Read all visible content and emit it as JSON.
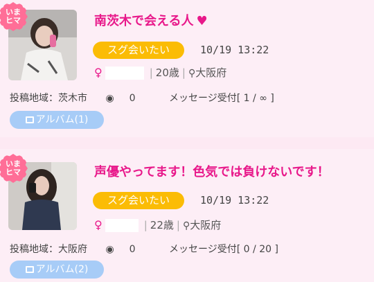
{
  "posts": [
    {
      "badge": "いま\nヒマ",
      "badge_line1": "いま",
      "badge_line2": "ヒマ",
      "title": "南茨木で会える人",
      "title_icon": "heart-icon",
      "status": "スグ会いたい",
      "datetime": "10/19 13:22",
      "gender_symbol": "♀",
      "age": "20歳",
      "location": "大阪府",
      "area_label": "投稿地域：茨木市",
      "views": "0",
      "message_label": "メッセージ受付[ 1 / ∞ ]",
      "album": "アルバム(1)"
    },
    {
      "badge": "いま\nヒマ",
      "badge_line1": "いま",
      "badge_line2": "ヒマ",
      "title": "声優やってます！色気では負けないです！",
      "status": "スグ会いたい",
      "datetime": "10/19 13:22",
      "gender_symbol": "♀",
      "age": "22歳",
      "location": "大阪府",
      "area_label": "投稿地域：大阪府",
      "views": "0",
      "message_label": "メッセージ受付[ 0 / 20 ]",
      "album": "アルバム(2)"
    }
  ],
  "colors": {
    "title": "#e8188a",
    "status_pill": "#fbbc05",
    "album_button": "#a7ccf7",
    "badge": "#ff6e97",
    "card_bg": "#fdeef6"
  }
}
